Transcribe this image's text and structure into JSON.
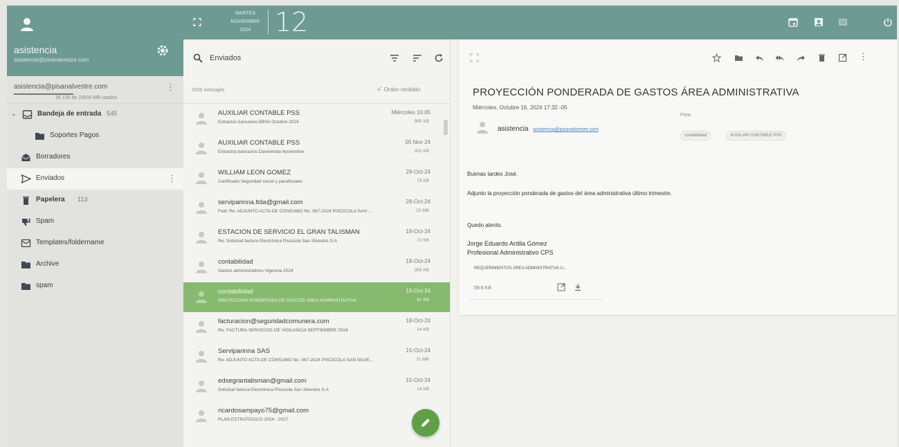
{
  "account": {
    "name": "asistencia",
    "email_header": "asistencia@pisanalvestre.com",
    "email_row": "asistencia@pisanalvestre.com",
    "quota": "36 135 de 25600 MB usados"
  },
  "folders": [
    {
      "label": "Bandeja de entrada",
      "count": "545",
      "icon": "inbox-icon",
      "indent": 0,
      "bold": true
    },
    {
      "label": "Soportes Pagos",
      "count": "",
      "icon": "folder-icon",
      "indent": 1,
      "bold": false
    },
    {
      "label": "Borradores",
      "count": "",
      "icon": "drafts-icon",
      "indent": 0,
      "bold": false
    },
    {
      "label": "Enviados",
      "count": "",
      "icon": "send-icon",
      "indent": 0,
      "bold": false,
      "active": true
    },
    {
      "label": "Papelera",
      "count": "113",
      "icon": "trash-icon",
      "indent": 0,
      "bold": true
    },
    {
      "label": "Spam",
      "count": "",
      "icon": "thumb-down-icon",
      "indent": 0,
      "bold": false
    },
    {
      "label": "Templates/foldername",
      "count": "",
      "icon": "template-icon",
      "indent": 0,
      "bold": false
    },
    {
      "label": "Archive",
      "count": "",
      "icon": "folder-icon",
      "indent": 0,
      "bold": false
    },
    {
      "label": "spam",
      "count": "",
      "icon": "folder-icon",
      "indent": 0,
      "bold": false
    }
  ],
  "topbar": {
    "weekday": "MARTES",
    "month": "NOVIEMBRE",
    "year": "2024",
    "day": "12"
  },
  "list": {
    "search_label": "Enviados",
    "message_count": "3100 mensajes",
    "order_label": "Orden recibido",
    "messages": [
      {
        "sender": "AUXILIAR CONTABLE PSS",
        "subject": "Extractos bancarios BBVA Octubre 2024",
        "date": "Miércoles 10:05",
        "size": "985 KB"
      },
      {
        "sender": "AUXILIAR CONTABLE PSS",
        "subject": "Extractos bancarios Davivienda Noviembre",
        "date": "05 Nov 24",
        "size": "201 KB"
      },
      {
        "sender": "WILLIAM LEON GOMEZ",
        "subject": "Certificado Seguridad social y parafiscales",
        "date": "29-Oct-24",
        "size": "73 KB"
      },
      {
        "sender": "serviparinna.ltda@gmail.com",
        "subject": "Fwd: Re: ADJUNTO ACTA DE CONSUMO No. 067-2024 PISCICOLA SAN ...",
        "date": "28-Oct-24",
        "size": "22 MB"
      },
      {
        "sender": "ESTACION DE SERVICIO EL GRAN TALISMAN",
        "subject": "Re: Solicitud factura Electrónica Piscicola San Silvestre S.A",
        "date": "18-Oct-24",
        "size": "72 KB"
      },
      {
        "sender": "contabilidad",
        "subject": "Gastos administrativos Vigencia 2024",
        "date": "18-Oct-24",
        "size": "359 KB"
      },
      {
        "sender": "contabilidad",
        "subject": "PROYECCIÓN PONDERADA DE GASTOS ÁREA ADMINISTRATIVA",
        "date": "16-Oct-24",
        "size": "81 KB",
        "selected": true
      },
      {
        "sender": "facturacion@seguridadcomunera.com",
        "subject": "Re: FACTURA SERVICIOS DE VIGILANCIA SEPTIEMBRE 2024",
        "date": "18-Oct-24",
        "size": "14 KB"
      },
      {
        "sender": "Serviparinna SAS",
        "subject": "Re: ADJUNTO ACTA DE CONSUMO No. 067-2024 PISCICOLA SAN SILVE...",
        "date": "15-Oct-24",
        "size": "11 MB"
      },
      {
        "sender": "edsegrantalisman@gmail.com",
        "subject": "Solicitud factura Electrónica Piscicola San Silvestre S.A",
        "date": "15-Oct-24",
        "size": "14 KB"
      },
      {
        "sender": "ricardosampayo75@gmail.com",
        "subject": "PLAN ESTRATEGICO 2024 - 2027",
        "date": "",
        "size": ""
      }
    ]
  },
  "reader": {
    "subject": "PROYECCIÓN PONDERADA DE GASTOS ÁREA ADMINISTRATIVA",
    "date": "Miércoles, Octubre 16, 2024 17:32 -05",
    "from_name": "asistencia",
    "from_email": "asistencia@pisanalvestre.com",
    "to_label": "Para",
    "recipients": [
      "contabilidad",
      "AUXILIAR CONTABLE PSS"
    ],
    "greeting": "Buenas tardes José.",
    "body": "Adjunto la proyección ponderada de gastos del área administrativa último trimestre.",
    "closing": "Quedo atento.",
    "signature_name": "Jorge Eduardo Ardila Gómez",
    "signature_title": "Profesional Administrativo CPS",
    "attachment_name": "REQUERIMIENTOS ÁREA ADMINISTRATIVA U...",
    "attachment_size": "59.6 KB"
  },
  "colors": {
    "accent": "#6d9a92",
    "selected": "#86ba6e",
    "fab": "#5fa046"
  }
}
